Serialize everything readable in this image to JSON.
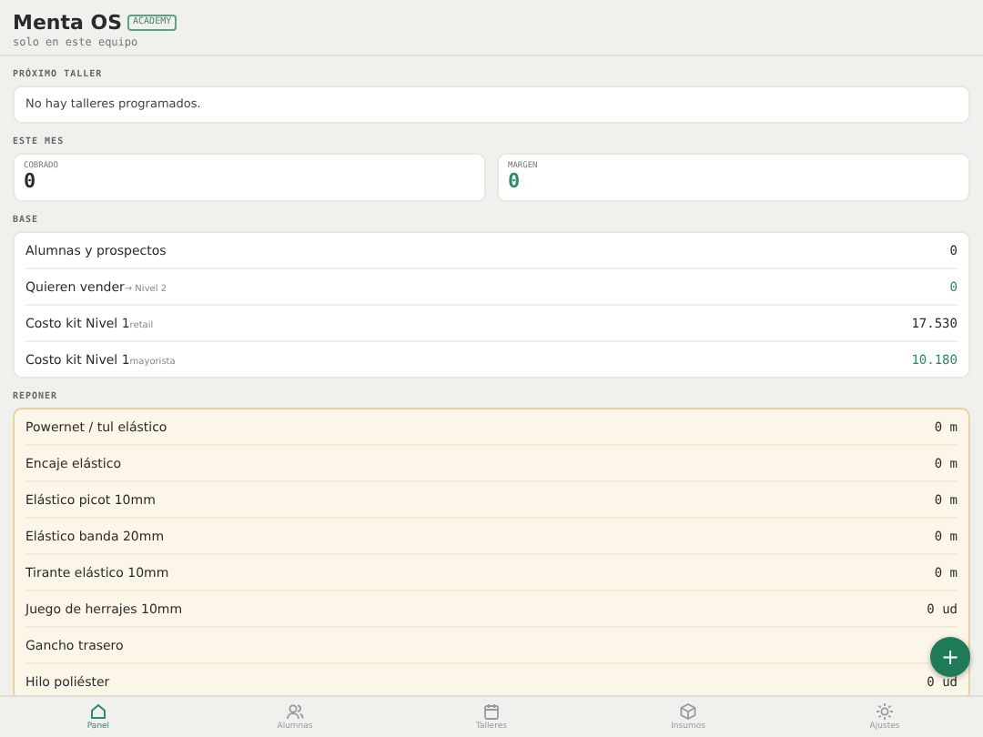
{
  "header": {
    "title": "Menta OS",
    "badge": "ACADEMY",
    "subtitle": "solo en este equipo"
  },
  "sections": [
    {
      "kind": "notice",
      "label": "PRÓXIMO TALLER",
      "text": "No hay talleres programados."
    },
    {
      "kind": "stats",
      "label": "ESTE MES",
      "stats": [
        {
          "label": "COBRADO",
          "value": "0",
          "accent": false
        },
        {
          "label": "MARGEN",
          "value": "0",
          "accent": true
        }
      ]
    },
    {
      "kind": "list",
      "label": "BASE",
      "rows": [
        {
          "name": "Alumnas y prospectos",
          "value": "0",
          "accent": false
        },
        {
          "name": "Quieren vender",
          "note": "→ Nivel 2",
          "value": "0",
          "accent": true
        },
        {
          "name": "Costo kit Nivel 1",
          "note": "retail",
          "value": "17.530",
          "accent": false
        },
        {
          "name": "Costo kit Nivel 1",
          "note": "mayorista",
          "value": "10.180",
          "accent": true
        }
      ]
    },
    {
      "kind": "stock",
      "label": "REPONER",
      "rows": [
        {
          "name": "Powernet / tul elástico",
          "value": "0 m"
        },
        {
          "name": "Encaje elástico",
          "value": "0 m"
        },
        {
          "name": "Elástico picot 10mm",
          "value": "0 m"
        },
        {
          "name": "Elástico banda 20mm",
          "value": "0 m"
        },
        {
          "name": "Tirante elástico 10mm",
          "value": "0 m"
        },
        {
          "name": "Juego de herrajes 10mm",
          "value": "0 ud"
        },
        {
          "name": "Gancho trasero"
        },
        {
          "name": "Hilo poliéster",
          "value": "0 ud"
        }
      ]
    }
  ],
  "fab": "+",
  "nav": [
    {
      "label": "Panel",
      "selected": true
    },
    {
      "label": "Alumnas",
      "selected": false
    },
    {
      "label": "Talleres",
      "selected": false
    },
    {
      "label": "Insumos",
      "selected": false
    },
    {
      "label": "Ajustes",
      "selected": false
    }
  ]
}
